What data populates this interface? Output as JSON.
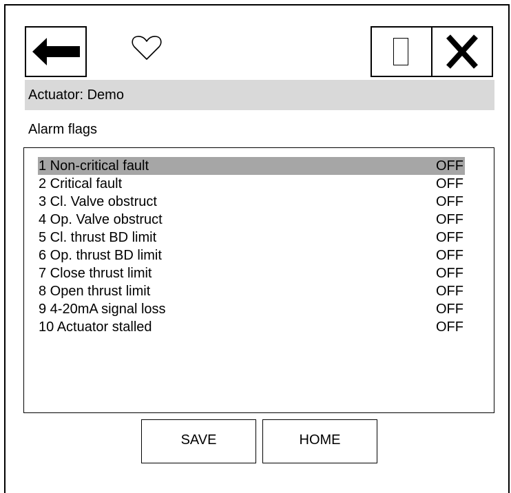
{
  "header": {
    "back_icon": "back-arrow-icon",
    "favorite_icon": "heart-icon",
    "window_icon": "window-square-icon",
    "close_icon": "close-x-icon"
  },
  "actuator": {
    "label": "Actuator: Demo"
  },
  "section": {
    "title": "Alarm flags"
  },
  "alarm_list": {
    "selected_index": 0,
    "items": [
      {
        "label": "1 Non-critical fault",
        "value": "OFF"
      },
      {
        "label": "2 Critical fault",
        "value": "OFF"
      },
      {
        "label": "3 Cl. Valve obstruct",
        "value": "OFF"
      },
      {
        "label": "4 Op. Valve obstruct",
        "value": "OFF"
      },
      {
        "label": "5 Cl. thrust BD limit",
        "value": "OFF"
      },
      {
        "label": "6 Op. thrust BD limit",
        "value": "OFF"
      },
      {
        "label": "7 Close thrust limit",
        "value": "OFF"
      },
      {
        "label": "8 Open thrust limit",
        "value": "OFF"
      },
      {
        "label": "9 4-20mA signal loss",
        "value": "OFF"
      },
      {
        "label": "10 Actuator stalled",
        "value": "OFF"
      }
    ]
  },
  "footer": {
    "save_label": "SAVE",
    "home_label": "HOME"
  },
  "colors": {
    "actuator_bar": "#d9d9d9",
    "selected_row": "#a6a6a6"
  }
}
